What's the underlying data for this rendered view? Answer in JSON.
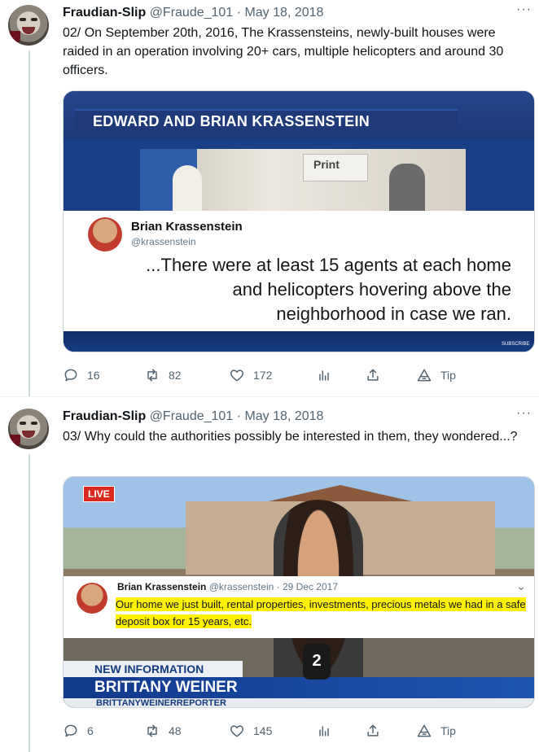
{
  "tweets": [
    {
      "name": "Fraudian-Slip",
      "handle": "@Fraude_101",
      "separator": "·",
      "date": "May 18, 2018",
      "more": "···",
      "text": "02/ On September 20th, 2016, The Krassensteins, newly-built houses were raided in an operation involving 20+ cars, multiple helicopters and around 30 officers.",
      "media": {
        "banner": "EDWARD AND BRIAN KRASSENSTEIN",
        "sign": "Print",
        "card_name": "Brian Krassenstein",
        "card_handle": "@krassenstein",
        "quote": "...There were at least 15 agents at each home and helicopters hovering above the neighborhood in case we ran.",
        "network": "SUBSCRIBE"
      },
      "actions": {
        "replies": "16",
        "retweets": "82",
        "likes": "172",
        "tip": "Tip"
      }
    },
    {
      "name": "Fraudian-Slip",
      "handle": "@Fraude_101",
      "separator": "·",
      "date": "May 18, 2018",
      "more": "···",
      "text": "03/ Why could the authorities possibly be interested in them, they wondered...?",
      "media": {
        "live": "LIVE",
        "card_name": "Brian Krassenstein",
        "card_handle": "@krassenstein",
        "card_date": "· 29 Dec 2017",
        "card_text": "Our home we just built, rental properties, investments, precious metals we had in a safe deposit box for 15 years, etc.",
        "lower_small": "NEW INFORMATION",
        "lower_big": "BRITTANY WEINER",
        "lower_social": "BRITTANYWEINERREPORTER",
        "channel": "2"
      },
      "actions": {
        "replies": "6",
        "retweets": "48",
        "likes": "145",
        "tip": "Tip"
      }
    }
  ]
}
